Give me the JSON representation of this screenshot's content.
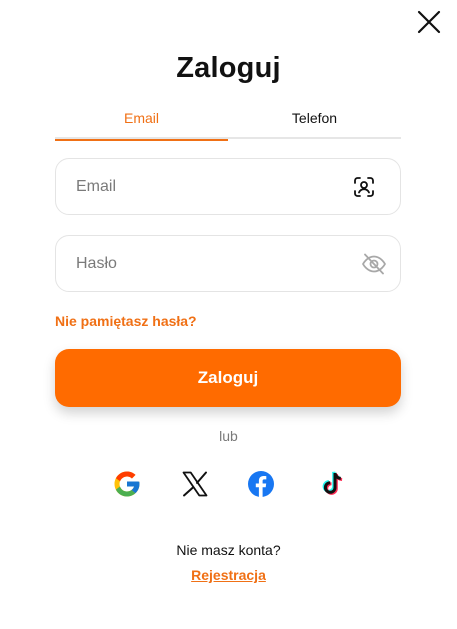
{
  "dialog": {
    "title": "Zaloguj",
    "close_icon": "close-icon"
  },
  "tabs": [
    {
      "label": "Email",
      "active": true
    },
    {
      "label": "Telefon",
      "active": false
    }
  ],
  "fields": {
    "email": {
      "value": "",
      "placeholder": "Email",
      "icon": "contact-scan-icon"
    },
    "password": {
      "value": "",
      "placeholder": "Hasło",
      "icon": "eye-off-icon"
    }
  },
  "forgot_password": "Nie pamiętasz hasła?",
  "login_button": "Zaloguj",
  "separator": "lub",
  "social_icons": [
    "google-icon",
    "x-icon",
    "facebook-icon",
    "tiktok-icon"
  ],
  "footer": {
    "no_account": "Nie masz konta?",
    "register_link": "Rejestracja"
  },
  "colors": {
    "accent": "#ff6b00",
    "accent_text": "#f07015",
    "border": "#e4e4e4",
    "muted_text": "#7a7a7a"
  }
}
